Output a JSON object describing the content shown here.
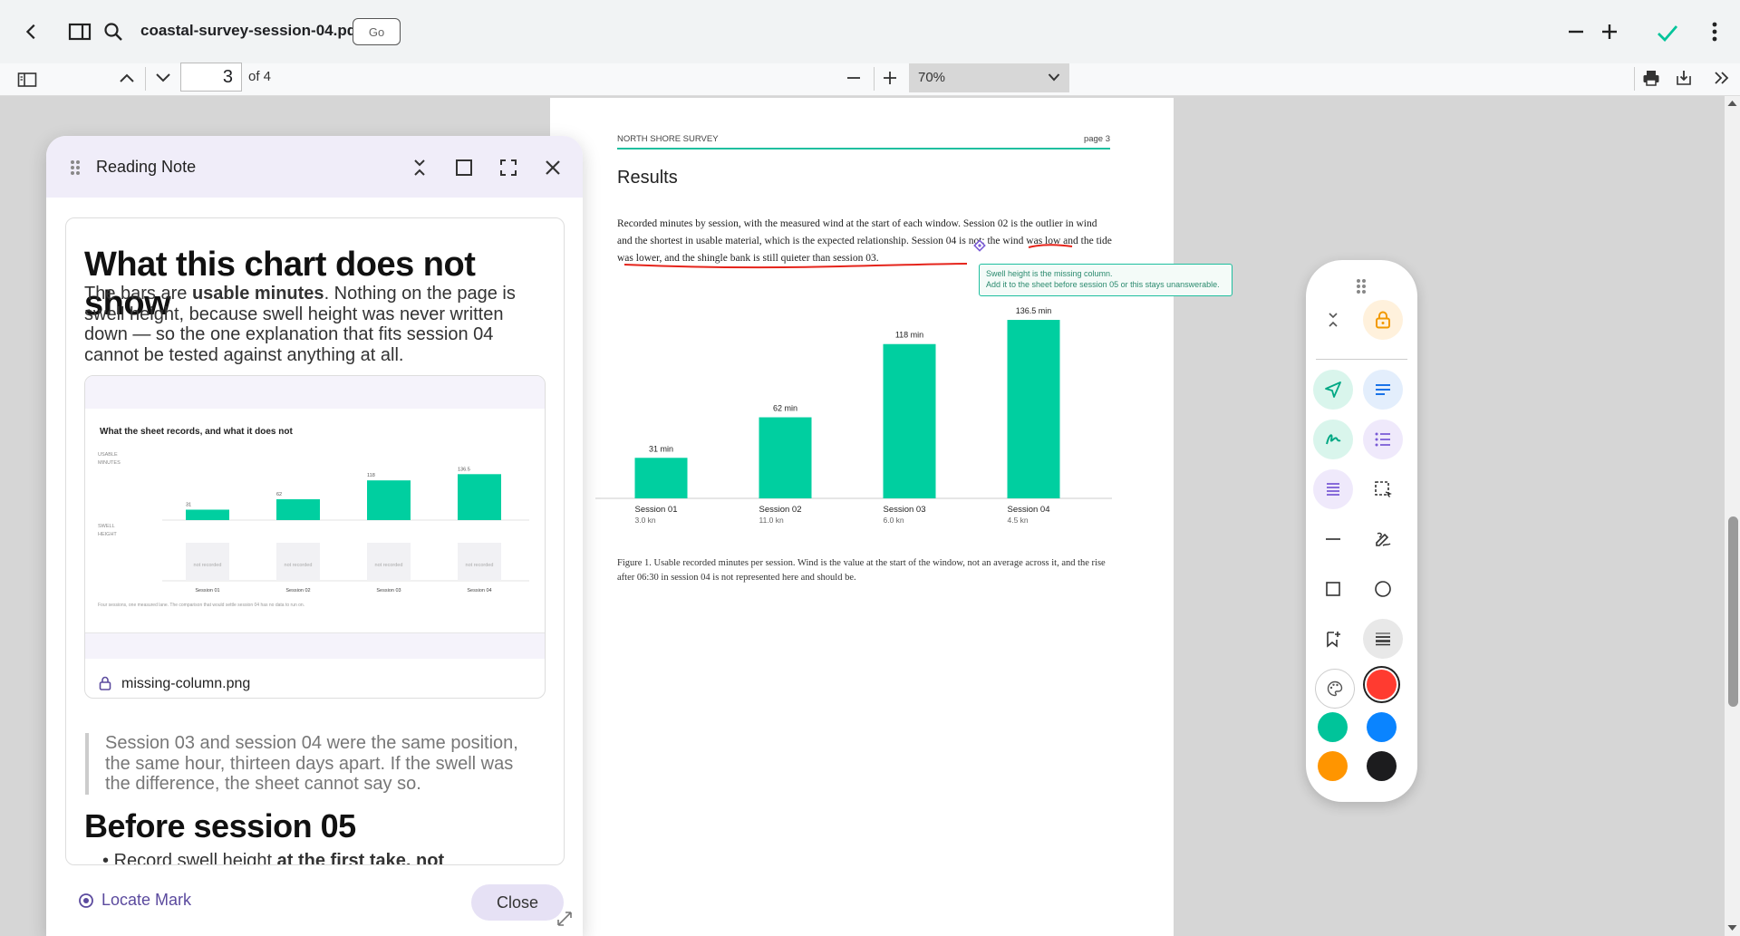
{
  "app": {
    "file_name": "coastal-survey-session-04.pdf",
    "go_label": "Go"
  },
  "pdf_toolbar": {
    "current_page": "3",
    "page_of": "of 4",
    "zoom": "70%"
  },
  "page": {
    "running_head_left": "NORTH SHORE SURVEY",
    "running_head_right": "page 3",
    "section_title": "Results",
    "paragraph": "Recorded minutes by session, with the measured wind at the start of each window. Session 02 is the outlier in wind and the shortest in usable material, which is the expected relationship. Session 04 is not: the wind was low and the tide was lower, and the shingle bank is still quieter than session 03.",
    "caption": "Figure 1. Usable recorded minutes per session. Wind is the value at the start of the window, not an average across it, and the rise after 06:30 in session 04 is not represented here and should be.",
    "comment_line1": "Swell height is the missing column.",
    "comment_line2": "Add it to the sheet before session 05 or this stays unanswerable."
  },
  "chart_data": {
    "type": "bar",
    "categories": [
      "Session 01",
      "Session 02",
      "Session 03",
      "Session 04"
    ],
    "sublabels": [
      "3.0 kn",
      "11.0 kn",
      "6.0 kn",
      "4.5 kn"
    ],
    "values": [
      31,
      62,
      118,
      136.5
    ],
    "value_labels": [
      "31 min",
      "62 min",
      "118 min",
      "136.5 min"
    ],
    "ylim": [
      0,
      140
    ],
    "color": "#00cfa0",
    "grid": false
  },
  "note": {
    "title": "Reading Note",
    "heading": "What this chart does not show",
    "para_pre": "The bars are ",
    "para_bold": "usable minutes",
    "para_post": ". Nothing on the page is swell height, because swell height was never written down — so the one explanation that fits session 04 cannot be tested against anything at all.",
    "image_title": "What the sheet records, and what it does not",
    "image_label_top": "USABLE MINUTES",
    "image_label_bottom": "SWELL HEIGHT",
    "image_values": [
      "31",
      "62",
      "118",
      "136.5"
    ],
    "image_not_recorded": "not recorded",
    "image_sessions": [
      "Session 01",
      "Session 02",
      "Session 03",
      "Session 04"
    ],
    "image_footnote": "Four sessions, one measured lane. The comparison that would settle session 04 has no data to run on.",
    "image_file": "missing-column.png",
    "quote": "Session 03 and session 04 were the same position, the same hour, thirteen days apart. If the swell was the difference, the sheet cannot say so.",
    "heading2": "Before session 05",
    "list_pre": "Record swell height ",
    "list_bold": "at the first take, not",
    "locate_label": "Locate Mark",
    "close_label": "Close"
  },
  "palette": {
    "accent": "#00c49a",
    "colors": [
      "#ff3b30",
      "#00c49a",
      "#0a84ff",
      "#ff9500",
      "#1c1c1e"
    ]
  }
}
